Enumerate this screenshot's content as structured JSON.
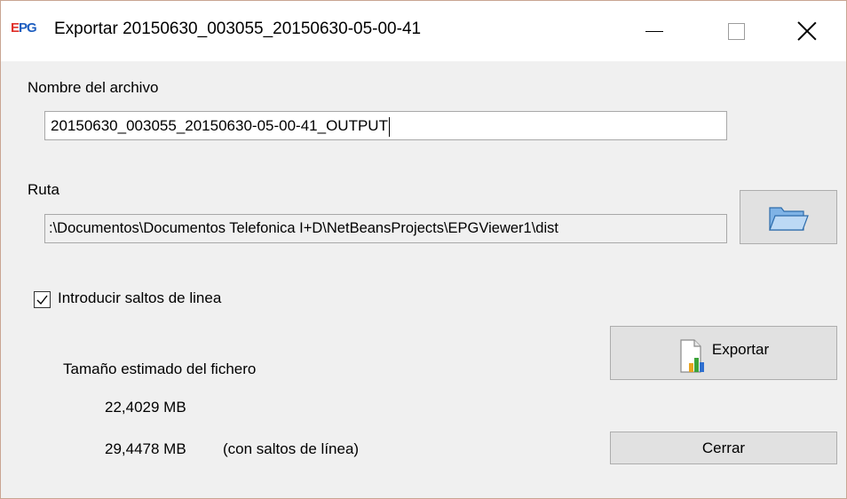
{
  "window": {
    "logo_e": "E",
    "logo_pg": "PG",
    "title": "Exportar 20150630_003055_20150630-05-00-41",
    "minimize_glyph": "",
    "close_glyph": ""
  },
  "form": {
    "filename_label": "Nombre del archivo",
    "filename_value": "20150630_003055_20150630-05-00-41_OUTPUT",
    "path_label": "Ruta",
    "path_value": ":\\Documentos\\Documentos Telefonica I+D\\NetBeansProjects\\EPGViewer1\\dist",
    "linebreaks_label": "Introducir saltos de linea",
    "linebreaks_checked": true
  },
  "size": {
    "heading": "Tamaño estimado del fichero",
    "size_plain": "22,4029 MB",
    "size_with_breaks": "29,4478 MB",
    "size_with_breaks_note": "(con saltos de línea)"
  },
  "buttons": {
    "export_label": "Exportar",
    "close_label": "Cerrar"
  },
  "icons": {
    "browse": "folder-icon",
    "export": "document-chart-icon",
    "check": "checkmark-icon"
  },
  "colors": {
    "logo_red": "#e0302a",
    "logo_blue": "#1f5fc0",
    "dialog_bg": "#f0f0f0",
    "button_bg": "#e1e1e1"
  }
}
